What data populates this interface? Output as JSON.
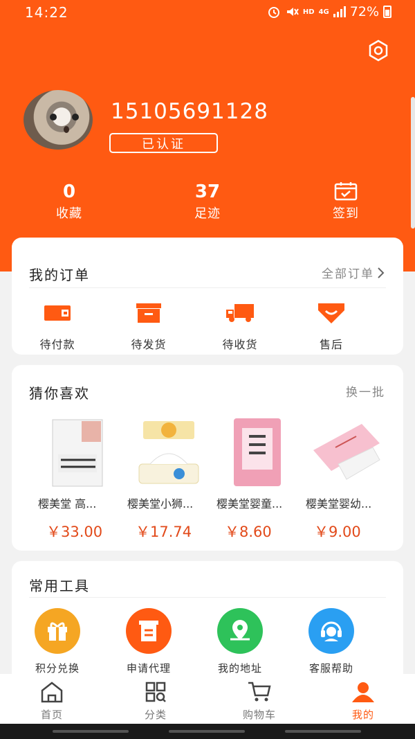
{
  "status_bar": {
    "time": "14:22",
    "hd": "HD",
    "network": "4G",
    "battery": "72%"
  },
  "profile": {
    "username": "15105691128",
    "verify_badge": "已认证"
  },
  "stats": {
    "favorites": {
      "count": "0",
      "label": "收藏"
    },
    "footprints": {
      "count": "37",
      "label": "足迹"
    },
    "checkin": {
      "label": "签到"
    }
  },
  "orders": {
    "title": "我的订单",
    "all_link": "全部订单",
    "items": [
      {
        "label": "待付款",
        "icon": "wallet-icon"
      },
      {
        "label": "待发货",
        "icon": "package-icon"
      },
      {
        "label": "待收货",
        "icon": "truck-icon"
      },
      {
        "label": "售后",
        "icon": "after-sale-icon"
      }
    ]
  },
  "guess": {
    "title": "猜你喜欢",
    "refresh": "换一批",
    "products": [
      {
        "name": "樱美堂 高...",
        "price": "￥33.00"
      },
      {
        "name": "樱美堂小狮...",
        "price": "￥17.74"
      },
      {
        "name": "樱美堂婴童...",
        "price": "￥8.60"
      },
      {
        "name": "樱美堂婴幼...",
        "price": "￥9.00"
      }
    ]
  },
  "tools": {
    "title": "常用工具",
    "items": [
      {
        "label": "积分兑换",
        "icon": "gift-icon",
        "color": "#f5a623"
      },
      {
        "label": "申请代理",
        "icon": "document-icon",
        "color": "#ff5a12"
      },
      {
        "label": "我的地址",
        "icon": "location-icon",
        "color": "#2ec25a"
      },
      {
        "label": "客服帮助",
        "icon": "headset-icon",
        "color": "#2a9ff2"
      }
    ]
  },
  "bottom_nav": [
    {
      "label": "首页",
      "icon": "home-icon"
    },
    {
      "label": "分类",
      "icon": "category-icon"
    },
    {
      "label": "购物车",
      "icon": "cart-icon"
    },
    {
      "label": "我的",
      "icon": "user-icon",
      "active": true
    }
  ],
  "colors": {
    "brand": "#ff5a12",
    "price": "#e24a1a"
  }
}
